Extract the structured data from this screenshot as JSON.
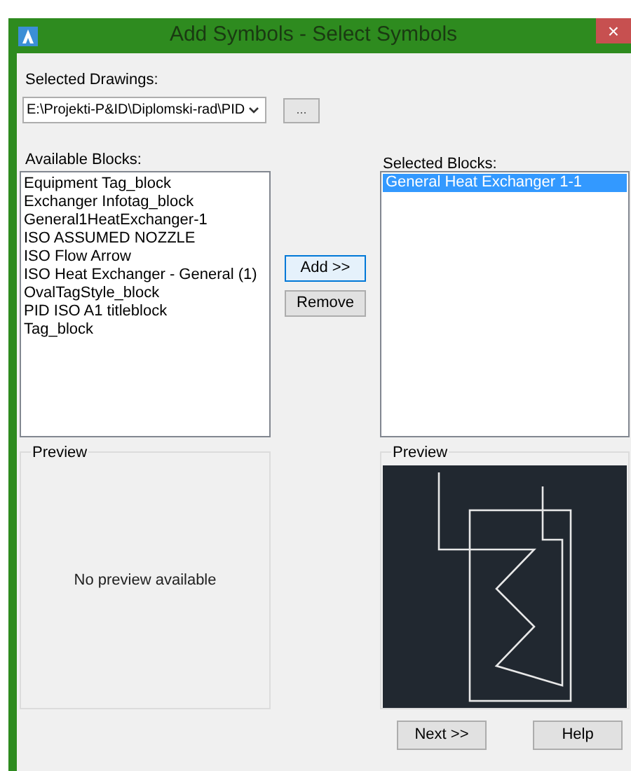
{
  "window": {
    "title": "Add Symbols - Select Symbols",
    "close": "×"
  },
  "selected_drawings": {
    "label": "Selected Drawings:",
    "value": "E:\\Projekti-P&ID\\Diplomski-rad\\PID",
    "browse_button": "..."
  },
  "available_blocks": {
    "label": "Available Blocks:",
    "items": [
      {
        "label": "Equipment Tag_block",
        "selected": false
      },
      {
        "label": "Exchanger Infotag_block",
        "selected": false
      },
      {
        "label": "General1HeatExchanger-1",
        "selected": false
      },
      {
        "label": "ISO ASSUMED NOZZLE",
        "selected": false
      },
      {
        "label": "ISO Flow Arrow",
        "selected": false
      },
      {
        "label": "ISO Heat Exchanger - General (1)",
        "selected": false
      },
      {
        "label": "OvalTagStyle_block",
        "selected": false
      },
      {
        "label": "PID ISO A1 titleblock",
        "selected": false
      },
      {
        "label": "Tag_block",
        "selected": false
      }
    ]
  },
  "actions": [
    {
      "label": "Add >>",
      "focused": true
    },
    {
      "label": "Remove",
      "focused": false
    }
  ],
  "selected_blocks": {
    "label": "Selected Blocks:",
    "items": [
      {
        "label": "General Heat Exchanger 1-1",
        "selected": true
      }
    ]
  },
  "left_preview": {
    "title": "Preview",
    "message": "No preview available"
  },
  "right_preview": {
    "title": "Preview"
  },
  "footer_buttons": [
    "Next >>",
    "Help"
  ]
}
